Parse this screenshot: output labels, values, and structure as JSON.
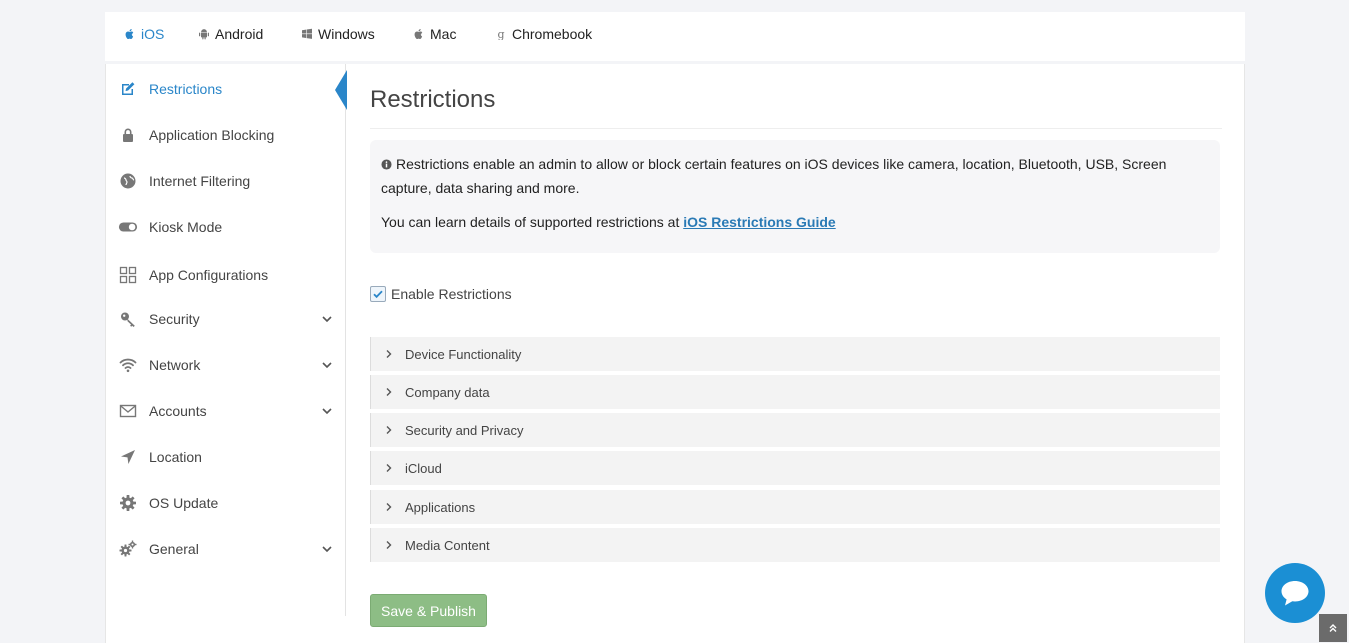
{
  "platform_tabs": [
    {
      "label": "iOS",
      "icon": "apple-icon",
      "active": true
    },
    {
      "label": "Android",
      "icon": "android-icon",
      "active": false
    },
    {
      "label": "Windows",
      "icon": "windows-icon",
      "active": false
    },
    {
      "label": "Mac",
      "icon": "apple-icon",
      "active": false
    },
    {
      "label": "Chromebook",
      "icon": "google-icon",
      "active": false
    }
  ],
  "sidebar": {
    "items": [
      {
        "label": "Restrictions",
        "icon": "edit-icon",
        "active": true
      },
      {
        "label": "Application Blocking",
        "icon": "lock-icon"
      },
      {
        "label": "Internet Filtering",
        "icon": "globe-icon"
      },
      {
        "label": "Kiosk Mode",
        "icon": "toggle-icon"
      },
      {
        "label": "App Configurations",
        "icon": "grid-icon"
      },
      {
        "label": "Security",
        "icon": "key-icon",
        "expandable": true
      },
      {
        "label": "Network",
        "icon": "wifi-icon",
        "expandable": true
      },
      {
        "label": "Accounts",
        "icon": "envelope-icon",
        "expandable": true
      },
      {
        "label": "Location",
        "icon": "location-arrow-icon"
      },
      {
        "label": "OS Update",
        "icon": "gear-icon"
      },
      {
        "label": "General",
        "icon": "gears-icon",
        "expandable": true
      }
    ]
  },
  "main": {
    "title": "Restrictions",
    "info": {
      "line1": "Restrictions enable an admin to allow or block certain features on iOS devices like camera, location, Bluetooth, USB, Screen capture, data sharing and more.",
      "line2_prefix": "You can learn details of supported restrictions at ",
      "link_text": "iOS Restrictions Guide"
    },
    "enable_checkbox": {
      "label": "Enable Restrictions",
      "checked": true
    },
    "sections": [
      {
        "label": "Device Functionality"
      },
      {
        "label": "Company data"
      },
      {
        "label": "Security and Privacy"
      },
      {
        "label": "iCloud"
      },
      {
        "label": "Applications"
      },
      {
        "label": "Media Content"
      }
    ],
    "save_button": "Save & Publish"
  },
  "colors": {
    "accent": "#2a86c9",
    "save_button": "#8dbd85",
    "chat_button": "#1b8fd4"
  }
}
